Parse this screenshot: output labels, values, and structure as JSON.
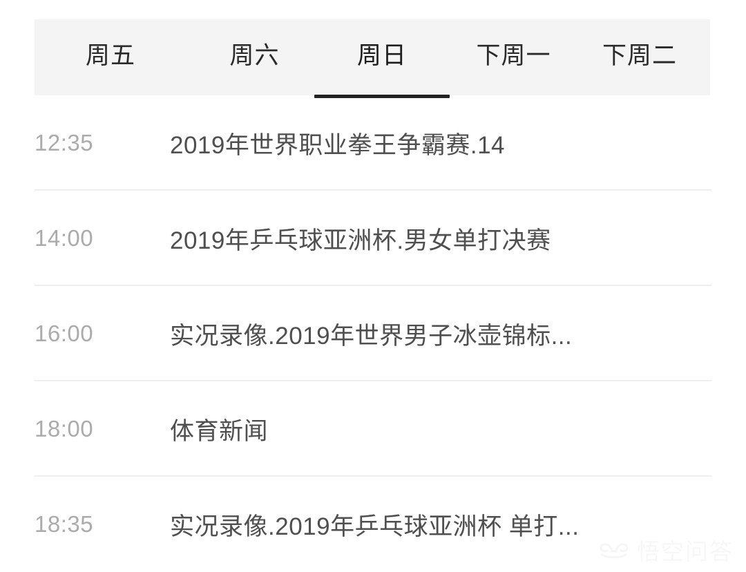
{
  "tabs": {
    "items": [
      {
        "label": "周五",
        "active": false
      },
      {
        "label": "周六",
        "active": false
      },
      {
        "label": "周日",
        "active": true
      },
      {
        "label": "下周一",
        "active": false
      },
      {
        "label": "下周二",
        "active": false
      }
    ]
  },
  "schedule": {
    "rows": [
      {
        "time": "12:35",
        "title": "2019年世界职业拳王争霸赛.14"
      },
      {
        "time": "14:00",
        "title": "2019年乒乓球亚洲杯.男女单打决赛"
      },
      {
        "time": "16:00",
        "title": "实况录像.2019年世界男子冰壶锦标..."
      },
      {
        "time": "18:00",
        "title": "体育新闻"
      },
      {
        "time": "18:35",
        "title": "实况录像.2019年乒乓球亚洲杯 单打..."
      }
    ]
  },
  "watermark": {
    "text": "悟空问答",
    "icon": "wukong-logo-icon"
  },
  "colors": {
    "tabbar_background": "#f4f4f4",
    "tab_text": "#2a2a2a",
    "active_underline": "#222222",
    "time_text": "#ababab",
    "title_text": "#4f4f4f",
    "divider": "#eeeeee",
    "page_background": "#ffffff",
    "watermark_text": "#f7f7f7"
  }
}
